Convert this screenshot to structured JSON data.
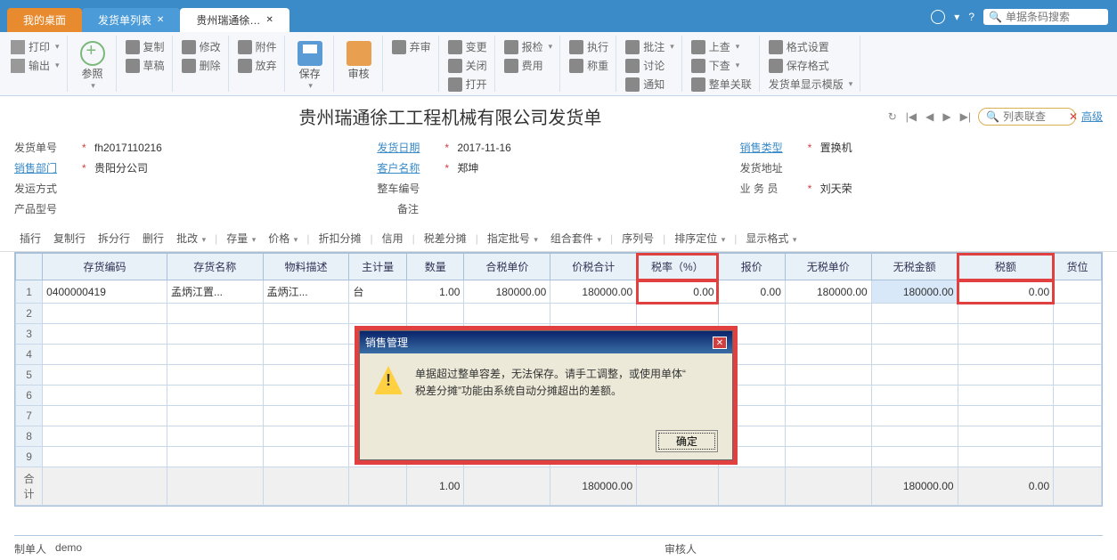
{
  "tabs": [
    {
      "label": "我的桌面"
    },
    {
      "label": "发货单列表"
    },
    {
      "label": "贵州瑞通徐…"
    }
  ],
  "top_search_placeholder": "单据条码搜索",
  "ribbon": {
    "print": "打印",
    "output": "输出",
    "ref": "参照",
    "copy": "复制",
    "draft": "草稿",
    "modify": "修改",
    "delete": "删除",
    "attach": "附件",
    "abandon": "放弃",
    "save": "保存",
    "audit": "审核",
    "deaudit": "弃审",
    "change": "变更",
    "close": "关闭",
    "open": "打开",
    "recheck": "报检",
    "fee": "费用",
    "exec": "执行",
    "weigh": "称重",
    "approve": "批注",
    "discuss": "讨论",
    "notify": "通知",
    "up": "上查",
    "down": "下查",
    "close_all": "整单关联",
    "fmt": "格式设置",
    "savefmt": "保存格式",
    "display_tpl": "发货单显示模版"
  },
  "title": "贵州瑞通徐工工程机械有限公司发货单",
  "nav": {
    "list_search_placeholder": "列表联查",
    "advanced": "高级"
  },
  "form": {
    "doc_no_label": "发货单号",
    "doc_no": "fh2017110216",
    "date_label": "发货日期",
    "date": "2017-11-16",
    "sale_type_label": "销售类型",
    "sale_type": "置换机",
    "dept_label": "销售部门",
    "dept": "贵阳分公司",
    "cust_label": "客户名称",
    "cust": "郑坤",
    "addr_label": "发货地址",
    "addr": "",
    "ship_label": "发运方式",
    "ship": "",
    "veh_label": "整车编号",
    "veh": "",
    "sales_label": "业 务 员",
    "sales": "刘天荣",
    "prod_label": "产品型号",
    "prod": "",
    "remark_label": "备注",
    "remark": ""
  },
  "table_toolbar": [
    "插行",
    "复制行",
    "拆分行",
    "删行",
    "批改",
    "存量",
    "价格",
    "折扣分摊",
    "信用",
    "税差分摊",
    "指定批号",
    "组合套件",
    "序列号",
    "排序定位",
    "显示格式"
  ],
  "columns": [
    "存货编码",
    "存货名称",
    "物料描述",
    "主计量",
    "数量",
    "合税单价",
    "价税合计",
    "税率（%）",
    "报价",
    "无税单价",
    "无税金额",
    "税额",
    "货位"
  ],
  "rows": [
    {
      "n": "1",
      "code": "0400000419",
      "name": "孟炳江置...",
      "desc": "孟炳江...",
      "unit": "台",
      "qty": "1.00",
      "price_tax": "180000.00",
      "total_tax": "180000.00",
      "rate": "0.00",
      "quote": "0.00",
      "price": "180000.00",
      "amount": "180000.00",
      "tax": "0.00",
      "loc": ""
    }
  ],
  "sum": {
    "label": "合计",
    "qty": "1.00",
    "total_tax": "180000.00",
    "amount": "180000.00",
    "tax": "0.00"
  },
  "modal": {
    "title": "销售管理",
    "msg1": "单据超过整单容差，无法保存。请手工调整，或使用单体“",
    "msg2": "税差分摊”功能由系统自动分摊超出的差额。",
    "ok": "确定"
  },
  "footer": {
    "maker_label": "制单人",
    "maker": "demo",
    "auditor_label": "审核人",
    "auditor": ""
  }
}
